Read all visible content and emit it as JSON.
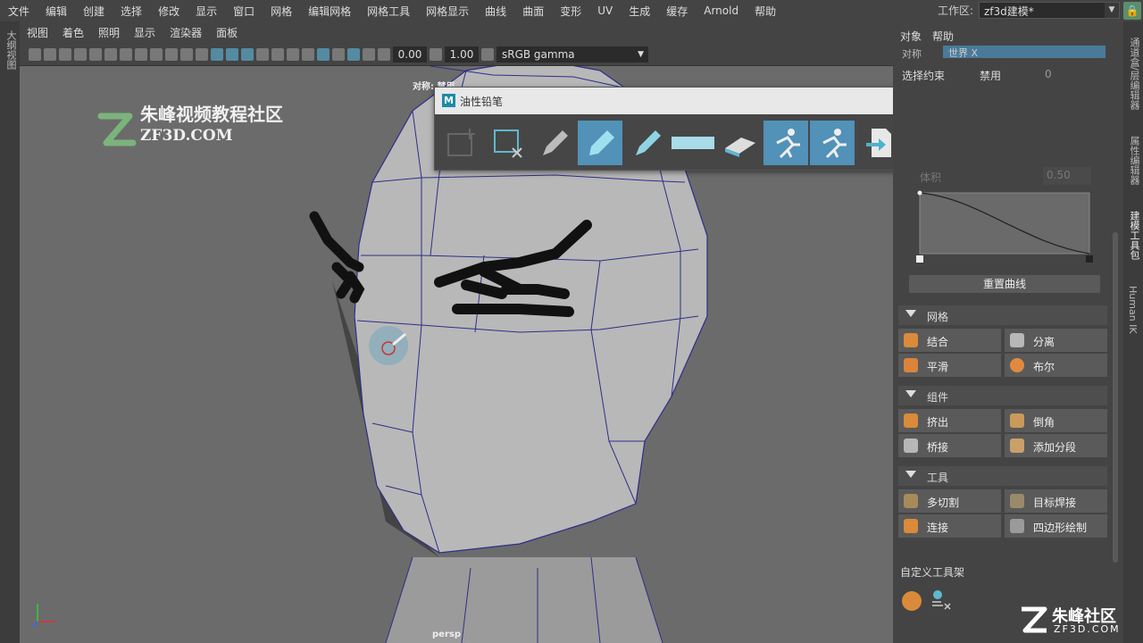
{
  "menu": [
    "文件",
    "编辑",
    "创建",
    "选择",
    "修改",
    "显示",
    "窗口",
    "网格",
    "编辑网格",
    "网格工具",
    "网格显示",
    "曲线",
    "曲面",
    "变形",
    "UV",
    "生成",
    "缓存",
    "Arnold",
    "帮助"
  ],
  "workspace": {
    "label": "工作区:",
    "value": "zf3d建模*"
  },
  "left_strip_label": "大纲视图",
  "panel_menu": [
    "视图",
    "着色",
    "照明",
    "显示",
    "渲染器",
    "面板"
  ],
  "view_toolbar": {
    "value1": "0.00",
    "value2": "1.00",
    "colorspace": "sRGB gamma"
  },
  "logo": {
    "line1": "朱峰视频教程社区",
    "line2": "ZF3D.COM"
  },
  "viewport": {
    "camera_label": "persp",
    "object_label": "对称: 禁用"
  },
  "grease_pencil": {
    "title": "油性铅笔",
    "logo_letter": "M"
  },
  "right_panel": {
    "menu": [
      "对象",
      "帮助"
    ],
    "symmetry_label": "对称",
    "symmetry_value": "世界 X",
    "constraint_label": "选择约束",
    "constraint_value": "禁用",
    "constraint_num": "0",
    "falloff_label": "体积",
    "falloff_value": "0.50",
    "reset_curve": "重置曲线",
    "sections": [
      {
        "title": "网格",
        "buttons": [
          "结合",
          "分离",
          "平滑",
          "布尔"
        ]
      },
      {
        "title": "组件",
        "buttons": [
          "挤出",
          "倒角",
          "桥接",
          "添加分段"
        ]
      },
      {
        "title": "工具",
        "buttons": [
          "多切割",
          "目标焊接",
          "连接",
          "四边形绘制"
        ]
      }
    ],
    "custom_shelf": "自定义工具架"
  },
  "right_strip_labels": [
    "通道盒/层编辑器",
    "属性编辑器",
    "建模工具包",
    "Human IK"
  ],
  "watermark": {
    "brand": "朱峰社区",
    "url": "ZF3D.COM"
  }
}
